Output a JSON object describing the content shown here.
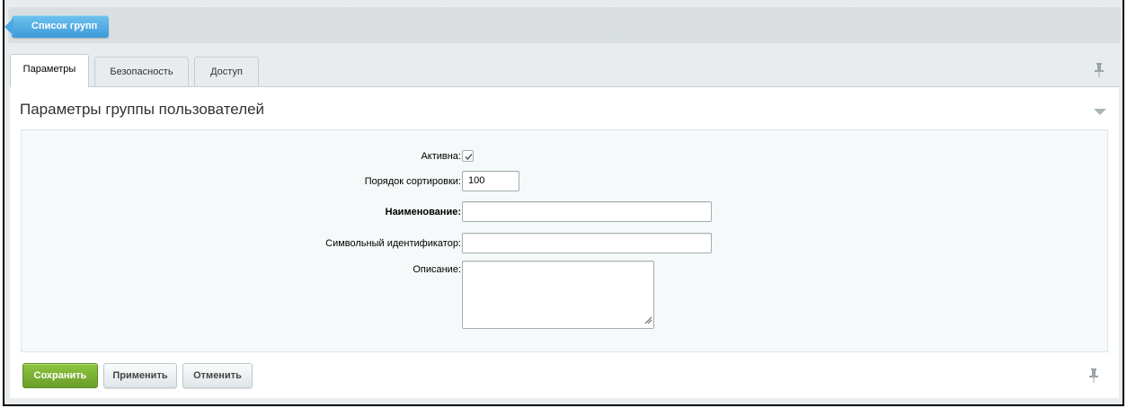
{
  "toolbar": {
    "back_label": "Список групп"
  },
  "tabs": [
    {
      "label": "Параметры",
      "active": true
    },
    {
      "label": "Безопасность",
      "active": false
    },
    {
      "label": "Доступ",
      "active": false
    }
  ],
  "section": {
    "title": "Параметры группы пользователей"
  },
  "form": {
    "active_label": "Активна:",
    "active_checked": true,
    "sort_label": "Порядок сортировки:",
    "sort_value": "100",
    "name_label": "Наименование:",
    "name_value": "",
    "code_label": "Символьный идентификатор:",
    "code_value": "",
    "description_label": "Описание:",
    "description_value": ""
  },
  "buttons": {
    "save_label": "Сохранить",
    "apply_label": "Применить",
    "cancel_label": "Отменить"
  },
  "icons": {
    "back": "arrow-left-icon",
    "pin": "pin-icon",
    "collapse": "chevron-down-icon",
    "check": "check-icon",
    "resize": "resize-handle-icon"
  },
  "colors": {
    "accent_blue": "#3d9ad8",
    "save_green": "#6a9d2a",
    "background": "#e8ecee"
  }
}
